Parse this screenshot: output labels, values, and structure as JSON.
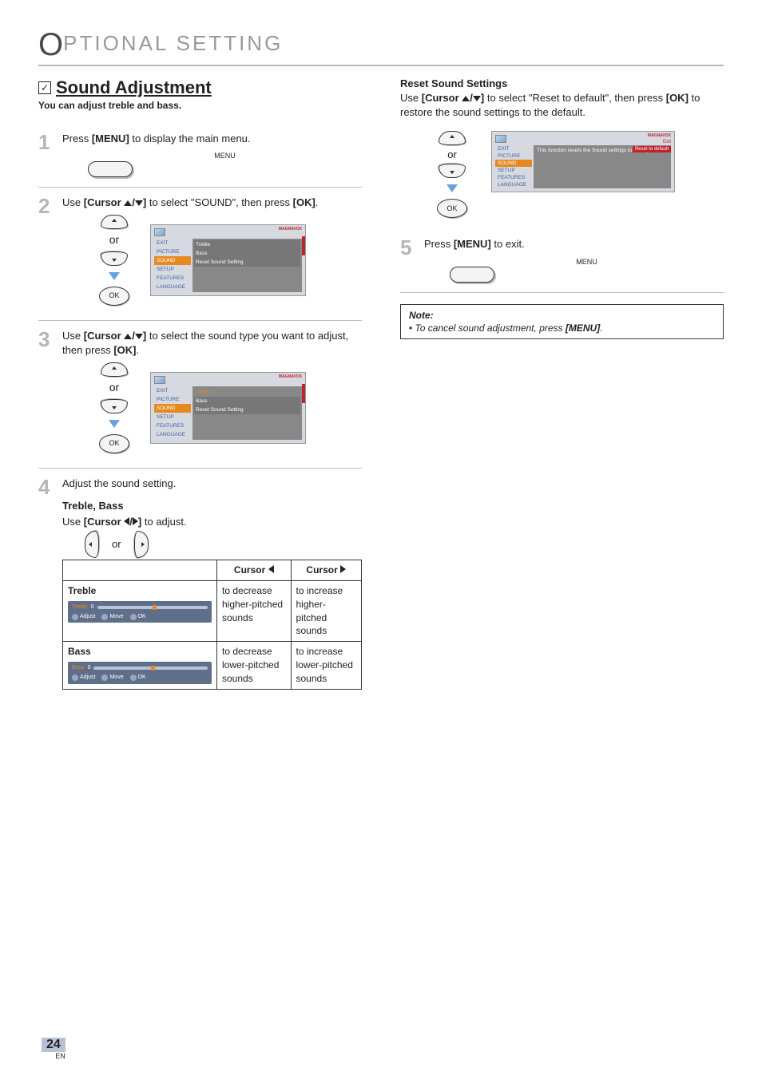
{
  "header": {
    "initial": "O",
    "rest": "PTIONAL   SETTING"
  },
  "left": {
    "checkbox": "✓",
    "title": "Sound Adjustment",
    "intro": "You can adjust treble and bass.",
    "steps": {
      "s1": {
        "num": "1",
        "pre": "Press ",
        "bold": "[MENU]",
        "post": " to display the main menu.",
        "menuLabel": "MENU"
      },
      "s2": {
        "num": "2",
        "pre": "Use ",
        "bold1": "[Cursor ",
        "bold2": "]",
        "mid": " to select \"SOUND\", then press ",
        "bold3": "[OK]",
        "end": ".",
        "or": "or",
        "ok": "OK"
      },
      "s3": {
        "num": "3",
        "pre": "Use ",
        "bold1": "[Cursor ",
        "bold2": "]",
        "mid": " to select the sound type you want to adjust, then press ",
        "bold3": "[OK]",
        "end": ".",
        "or": "or",
        "ok": "OK"
      },
      "s4": {
        "num": "4",
        "text": "Adjust the sound setting.",
        "sub": "Treble, Bass",
        "subdesc_pre": "Use ",
        "subdesc_bold": "[Cursor ",
        "subdesc_bold2": "]",
        "subdesc_post": " to adjust.",
        "or": "or"
      }
    },
    "menu": {
      "logo": "MAGNAVOX",
      "items": [
        "EXIT",
        "PICTURE",
        "SOUND",
        "SETUP",
        "FEATURES",
        "LANGUAGE"
      ],
      "sub1": [
        "Treble",
        "Bass",
        "Reset Sound Setting"
      ],
      "sub2_hl": "Treble",
      "sub2": [
        "Bass",
        "Reset Sound Setting"
      ]
    },
    "table": {
      "h0": "",
      "h1_pre": "Cursor",
      "h2_pre": "Cursor",
      "rows": [
        {
          "name": "Treble",
          "left": "to decrease higher-pitched sounds",
          "right": "to increase higher-pitched sounds",
          "slider": {
            "name": "Treble",
            "val": "0",
            "adjust": "Adjust",
            "move": "Move",
            "ok": "OK"
          }
        },
        {
          "name": "Bass",
          "left": "to decrease lower-pitched sounds",
          "right": "to increase lower-pitched sounds",
          "slider": {
            "name": "Bass",
            "val": "0",
            "adjust": "Adjust",
            "move": "Move",
            "ok": "OK"
          }
        }
      ]
    }
  },
  "right": {
    "title": "Reset Sound Settings",
    "desc_pre": "Use ",
    "desc_b1": "[Cursor ",
    "desc_b1b": "]",
    "desc_mid": " to select \"Reset to default\", then press ",
    "desc_b2": "[OK]",
    "desc_post": " to restore the sound settings to the default.",
    "or": "or",
    "ok": "OK",
    "menu": {
      "logo": "MAGNAVOX",
      "items": [
        "EXIT",
        "PICTURE",
        "SOUND",
        "SETUP",
        "FEATURES",
        "LANGUAGE"
      ],
      "msg": "This function resets the Sound settings to factory default.",
      "exit": "Exit",
      "reset": "Reset to default"
    },
    "step5": {
      "num": "5",
      "pre": "Press ",
      "bold": "[MENU]",
      "post": " to exit.",
      "menuLabel": "MENU"
    },
    "note": {
      "title": "Note:",
      "item_pre": "To cancel sound adjustment, press ",
      "item_bold": "[MENU]",
      "item_post": "."
    }
  },
  "page": {
    "num": "24",
    "lang": "EN"
  }
}
